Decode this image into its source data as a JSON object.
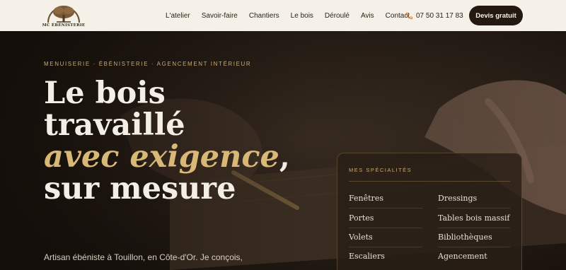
{
  "header": {
    "logo_text": "MC ÉBÉNISTERIE",
    "nav": [
      "L'atelier",
      "Savoir-faire",
      "Chantiers",
      "Le bois",
      "Déroulé",
      "Avis",
      "Contact"
    ],
    "phone": "07 50 31 17 83",
    "cta_label": "Devis gratuit"
  },
  "hero": {
    "eyebrow": "MENUISERIE · ÉBÉNISTERIE · AGENCEMENT INTÉRIEUR",
    "headline_1": "Le bois",
    "headline_2": "travaillé",
    "headline_accent": "avec exigence",
    "headline_comma": ",",
    "headline_4": "sur mesure",
    "subtext": "Artisan ébéniste à Touillon, en Côte-d'Or. Je conçois,"
  },
  "specialties": {
    "title": "MES SPÉCIALITÉS",
    "left": [
      "Fenêtres",
      "Portes",
      "Volets",
      "Escaliers"
    ],
    "right": [
      "Dressings",
      "Tables bois massif",
      "Bibliothèques",
      "Agencement"
    ]
  },
  "colors": {
    "accent": "#c9a96e",
    "dark": "#231911",
    "cream": "#f5f0e8"
  }
}
